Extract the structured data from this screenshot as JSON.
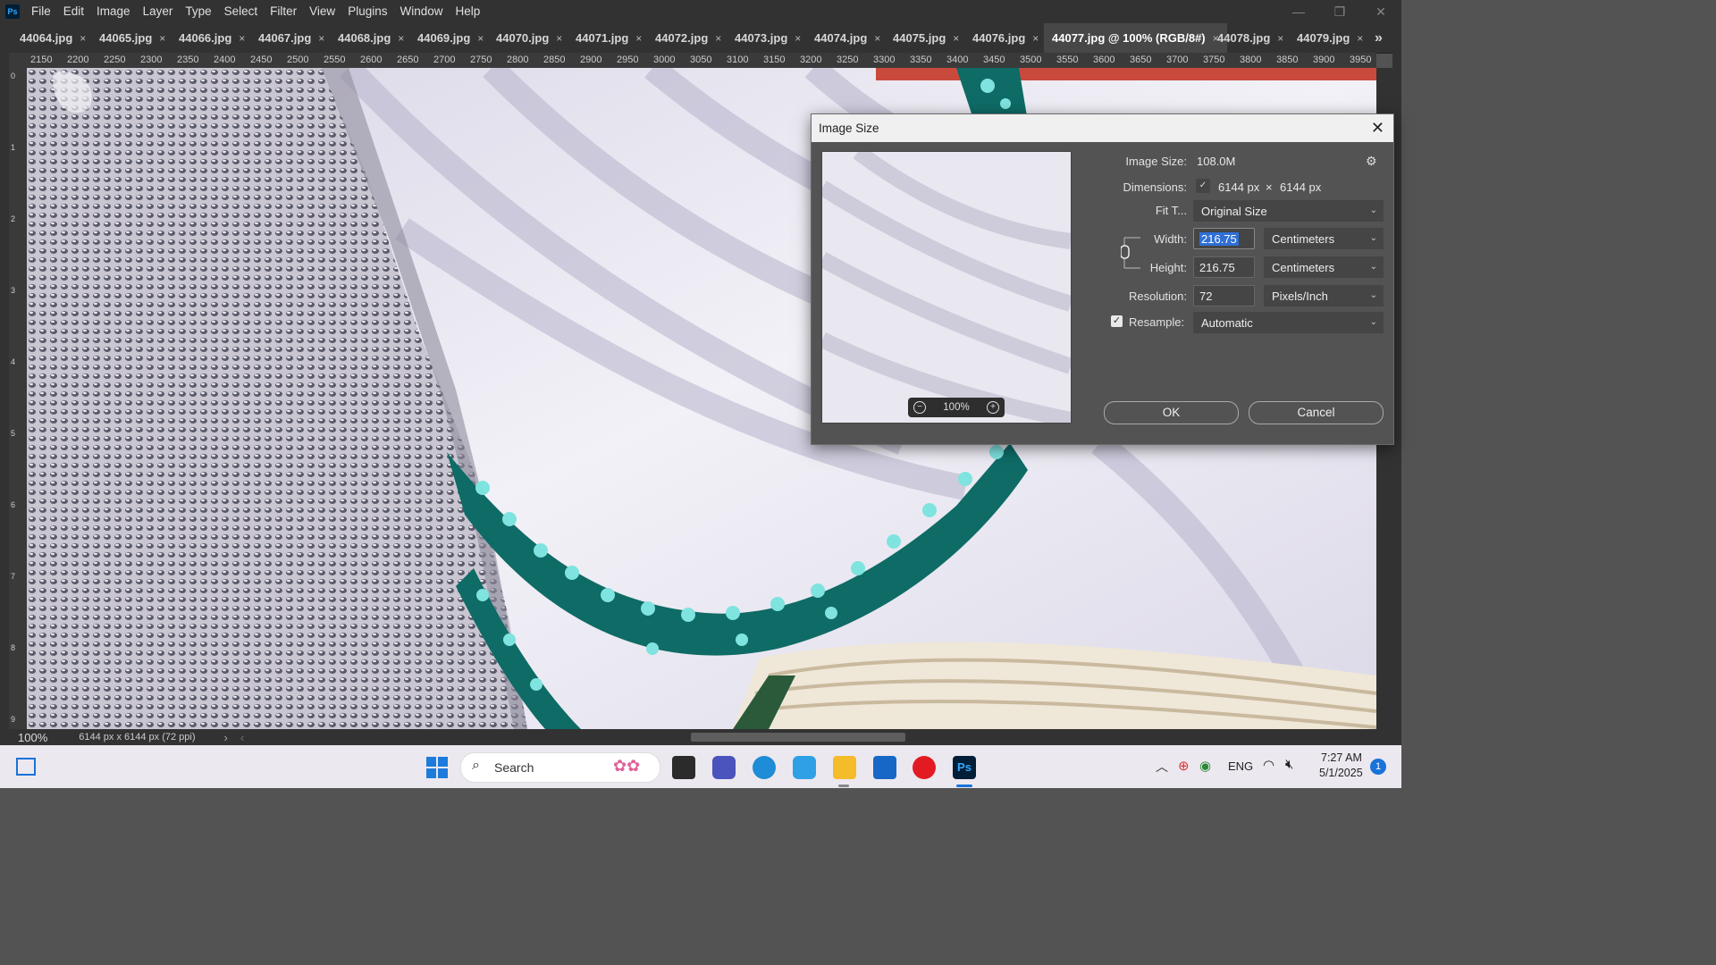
{
  "menu": {
    "logo": "Ps",
    "items": [
      "File",
      "Edit",
      "Image",
      "Layer",
      "Type",
      "Select",
      "Filter",
      "View",
      "Plugins",
      "Window",
      "Help"
    ]
  },
  "tabs": [
    {
      "label": "44064.jpg"
    },
    {
      "label": "44065.jpg"
    },
    {
      "label": "44066.jpg"
    },
    {
      "label": "44067.jpg"
    },
    {
      "label": "44068.jpg"
    },
    {
      "label": "44069.jpg"
    },
    {
      "label": "44070.jpg"
    },
    {
      "label": "44071.jpg"
    },
    {
      "label": "44072.jpg"
    },
    {
      "label": "44073.jpg"
    },
    {
      "label": "44074.jpg"
    },
    {
      "label": "44075.jpg"
    },
    {
      "label": "44076.jpg"
    },
    {
      "label": "44077.jpg @ 100% (RGB/8#)",
      "active": true
    },
    {
      "label": "44078.jpg"
    },
    {
      "label": "44079.jpg"
    }
  ],
  "tab_close_glyph": "×",
  "tab_overflow_glyph": "»",
  "ruler": {
    "h_ticks": [
      "2150",
      "2200",
      "2250",
      "2300",
      "2350",
      "2400",
      "2450",
      "2500",
      "2550",
      "2600",
      "2650",
      "2700",
      "2750",
      "2800",
      "2850",
      "2900",
      "2950",
      "3000",
      "3050",
      "3100",
      "3150",
      "3200",
      "3250",
      "3300",
      "3350",
      "3400",
      "3450",
      "3500",
      "3550",
      "3600",
      "3650",
      "3700",
      "3750",
      "3800",
      "3850",
      "3900",
      "3950"
    ],
    "v_ticks": [
      "0",
      "1",
      "2",
      "3",
      "4",
      "5",
      "6",
      "7",
      "8",
      "9"
    ]
  },
  "status": {
    "zoom": "100%",
    "doc_info": "6144 px x 6144 px (72 ppi)",
    "arrow_right": "›",
    "arrow_left": "‹"
  },
  "dialog": {
    "title": "Image Size",
    "close_glyph": "✕",
    "image_size_label": "Image Size:",
    "image_size_value": "108.0M",
    "dimensions_label": "Dimensions:",
    "dim_width": "6144 px",
    "dim_times": "×",
    "dim_height": "6144 px",
    "fit_label": "Fit T...",
    "fit_value": "Original Size",
    "width_label": "Width:",
    "width_value": "216.75",
    "width_unit": "Centimeters",
    "height_label": "Height:",
    "height_value": "216.75",
    "height_unit": "Centimeters",
    "resolution_label": "Resolution:",
    "resolution_value": "72",
    "resolution_unit": "Pixels/Inch",
    "resample_label": "Resample:",
    "resample_checked": true,
    "resample_value": "Automatic",
    "preview_zoom": "100%",
    "ok_label": "OK",
    "cancel_label": "Cancel"
  },
  "taskbar": {
    "search_placeholder": "Search",
    "language": "ENG",
    "time": "7:27 AM",
    "date": "5/1/2025",
    "notification_count": "1"
  },
  "colors": {
    "ps_blue": "#31a8ff",
    "ps_dark": "#001e36",
    "teal_beads": "#0e6b66",
    "fabric": "#e6e3ef"
  }
}
